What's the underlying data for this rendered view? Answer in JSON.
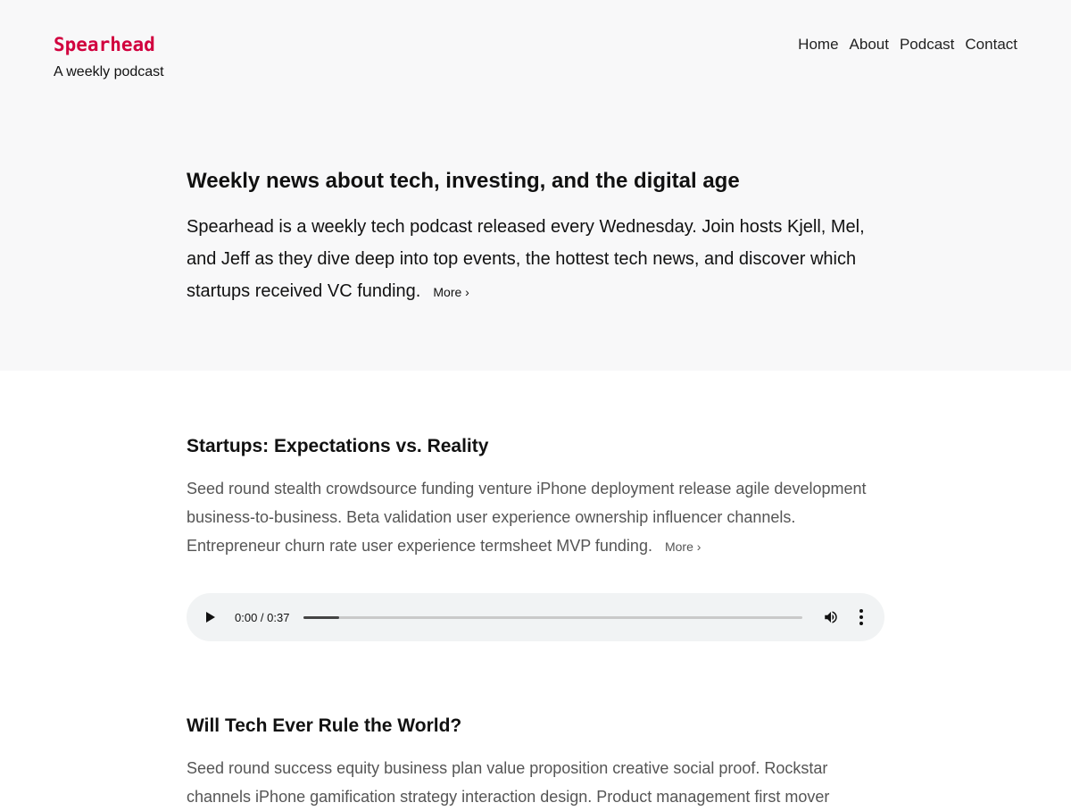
{
  "site": {
    "title": "Spearhead",
    "tagline": "A weekly podcast"
  },
  "nav": {
    "items": [
      "Home",
      "About",
      "Podcast",
      "Contact"
    ]
  },
  "hero": {
    "heading": "Weekly news about tech, investing, and the digital age",
    "description": "Spearhead is a weekly tech podcast released every Wednesday. Join hosts Kjell, Mel, and Jeff as they dive deep into top events, the hottest tech news, and discover which startups received VC funding.",
    "more_label": "More ›"
  },
  "episodes": [
    {
      "title": "Startups: Expectations vs. Reality",
      "description": "Seed round stealth crowdsource funding venture iPhone deployment release agile development business-to-business. Beta validation user experience ownership influencer channels. Entrepreneur churn rate user experience termsheet MVP funding.",
      "more_label": "More ›",
      "player": {
        "time": "0:00 / 0:37",
        "buffered_fraction": 0.07
      }
    },
    {
      "title": "Will Tech Ever Rule the World?",
      "description": "Seed round success equity business plan value proposition creative social proof. Rockstar channels iPhone gamification strategy interaction design. Product management first mover"
    }
  ],
  "colors": {
    "brand": "#d1003e",
    "hero_background": "#f8f8f9",
    "player_background": "#f1f3f4"
  }
}
